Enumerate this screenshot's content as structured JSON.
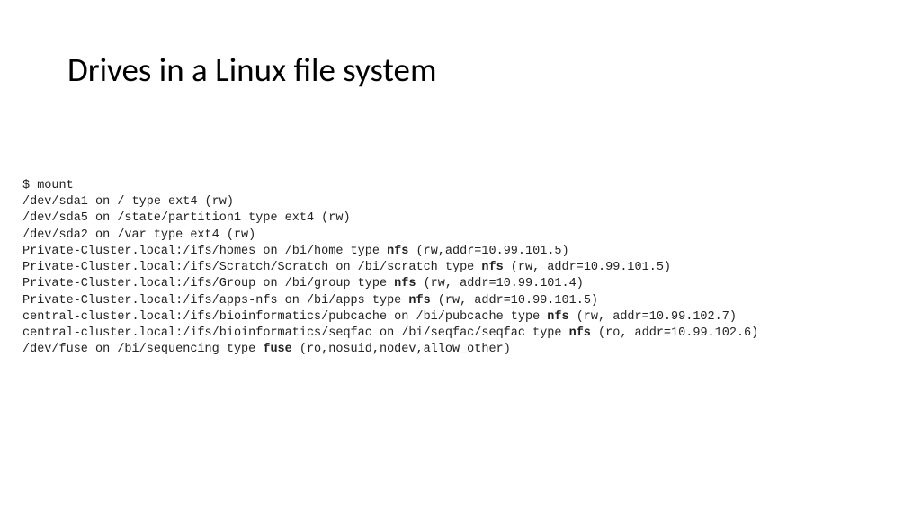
{
  "title": "Drives in a Linux file system",
  "prompt": "$ mount",
  "lines": [
    {
      "pre": "/dev/sda1 on / type ext4 (rw)",
      "bold": "",
      "post": ""
    },
    {
      "pre": "/dev/sda5 on /state/partition1 type ext4 (rw)",
      "bold": "",
      "post": ""
    },
    {
      "pre": "/dev/sda2 on /var type ext4 (rw)",
      "bold": "",
      "post": ""
    },
    {
      "pre": "Private-Cluster.local:/ifs/homes on /bi/home type ",
      "bold": "nfs",
      "post": " (rw,addr=10.99.101.5)"
    },
    {
      "pre": "Private-Cluster.local:/ifs/Scratch/Scratch on /bi/scratch type ",
      "bold": "nfs",
      "post": " (rw, addr=10.99.101.5)"
    },
    {
      "pre": "Private-Cluster.local:/ifs/Group on /bi/group type ",
      "bold": "nfs",
      "post": " (rw, addr=10.99.101.4)"
    },
    {
      "pre": "Private-Cluster.local:/ifs/apps-nfs on /bi/apps type ",
      "bold": "nfs",
      "post": " (rw, addr=10.99.101.5)"
    },
    {
      "pre": "central-cluster.local:/ifs/bioinformatics/pubcache on /bi/pubcache type ",
      "bold": "nfs",
      "post": " (rw, addr=10.99.102.7)"
    },
    {
      "pre": "central-cluster.local:/ifs/bioinformatics/seqfac on /bi/seqfac/seqfac type ",
      "bold": "nfs",
      "post": " (ro, addr=10.99.102.6)"
    },
    {
      "pre": "/dev/fuse on /bi/sequencing type ",
      "bold": "fuse",
      "post": " (ro,nosuid,nodev,allow_other)"
    }
  ]
}
